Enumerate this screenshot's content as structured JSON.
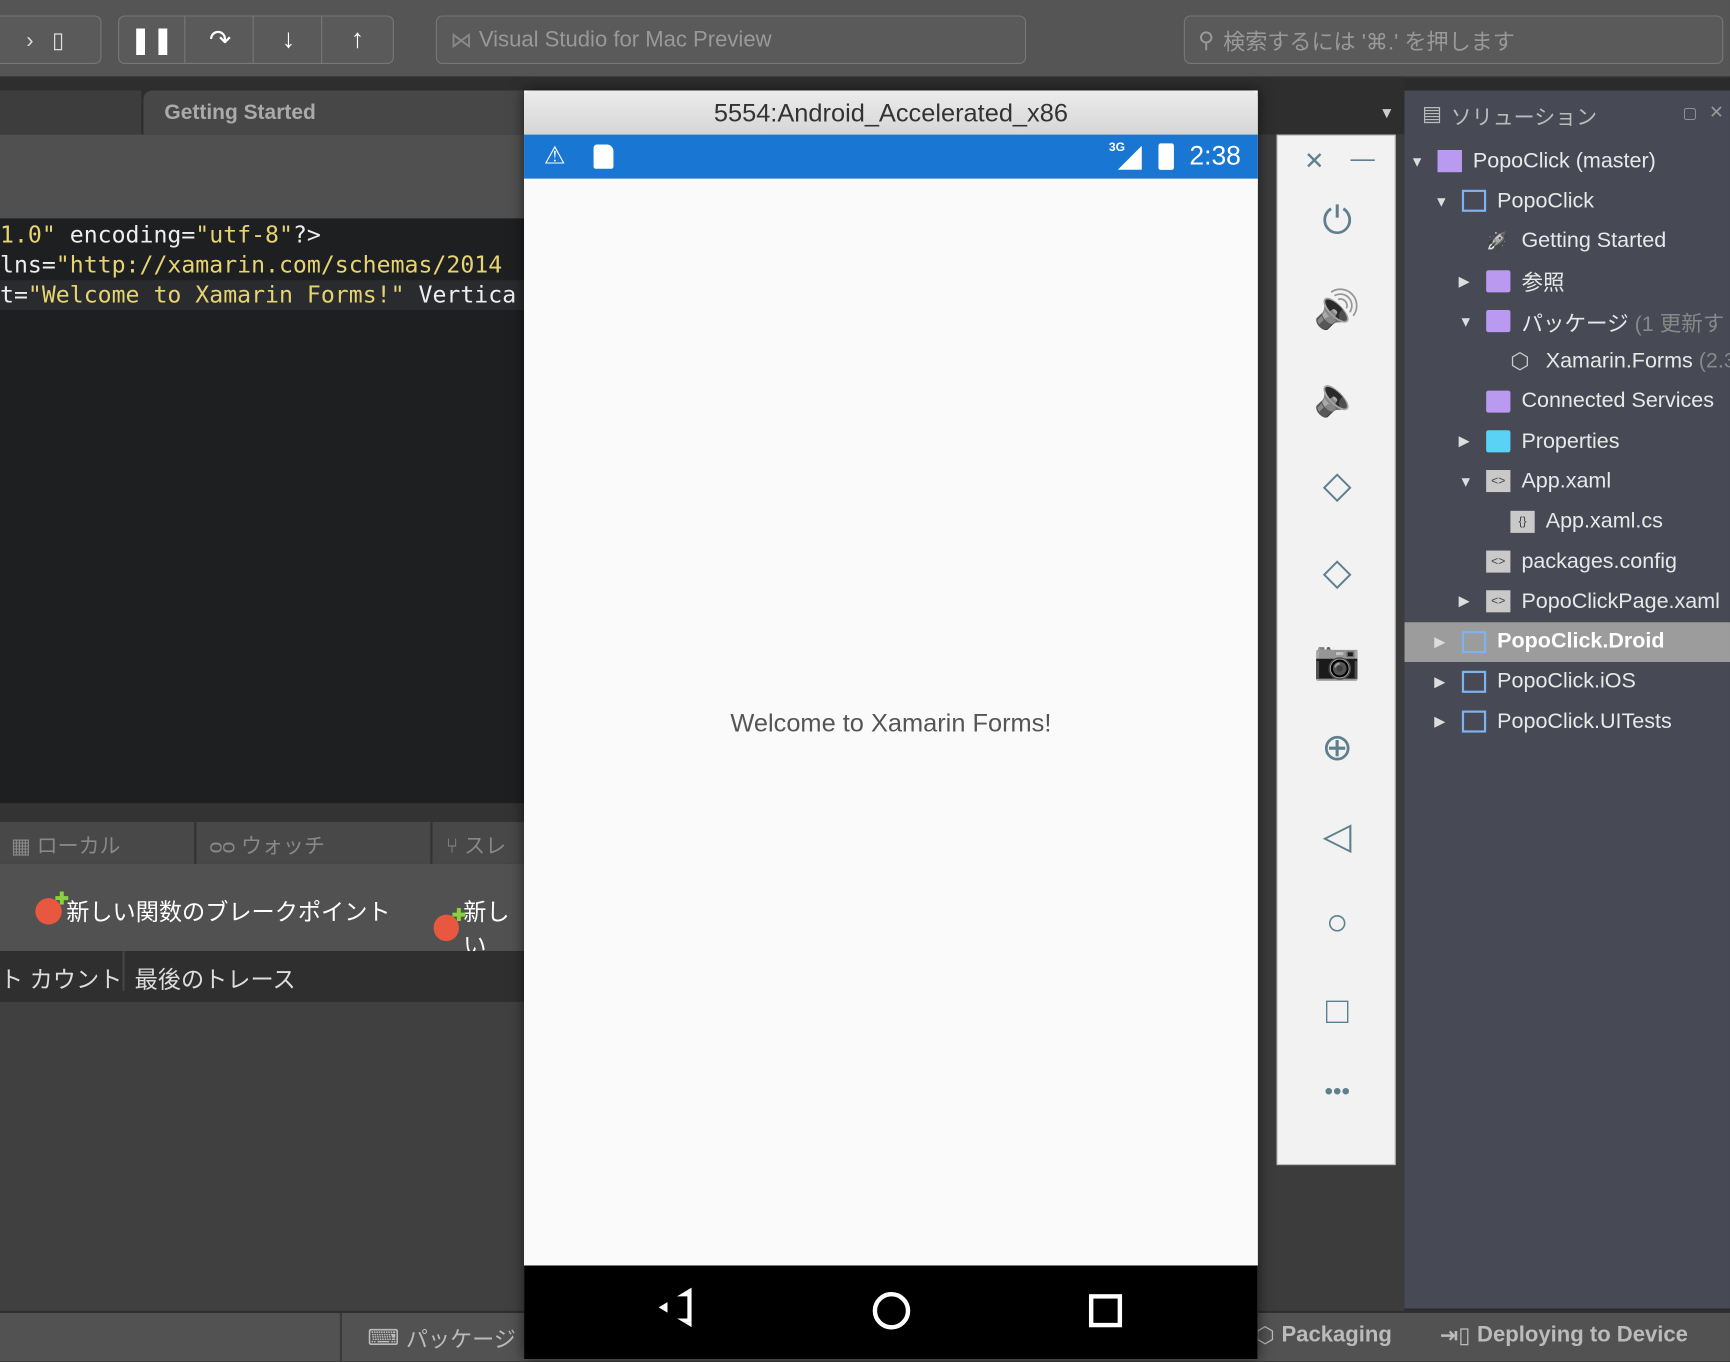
{
  "toolbar": {
    "app_title": "Visual Studio for Mac Preview",
    "search_placeholder": "検索するには '⌘.' を押します",
    "debug_buttons": [
      "pause-icon",
      "step-over-icon",
      "step-into-icon",
      "step-out-icon"
    ]
  },
  "editor": {
    "tab_label": "Getting Started",
    "lines": [
      {
        "a": "1.0\"",
        "b": " encoding=",
        "c": "\"utf-8\"",
        "d": "?>"
      },
      {
        "a": "lns=",
        "b": "",
        "c": "\"http://xamarin.com/schemas/2014",
        "d": ""
      },
      {
        "a": "t=",
        "b": "",
        "c": "\"Welcome to Xamarin Forms!\"",
        "d": " Vertica"
      }
    ]
  },
  "debug_pad": {
    "tabs": [
      "ローカル",
      "ウォッチ",
      "スレ"
    ],
    "new_function_breakpoint": "新しい関数のブレークポイント",
    "new_exception": "新しい",
    "columns": [
      "ト カウント",
      "最後のトレース"
    ]
  },
  "statusbar": {
    "package_console": "パッケージ コ",
    "packaging": "Packaging",
    "deploying": "Deploying to Device"
  },
  "solution": {
    "title": "ソリューション",
    "items": [
      {
        "label": "PopoClick (master)",
        "extra": ""
      },
      {
        "label": "PopoClick",
        "extra": ""
      },
      {
        "label": "Getting Started",
        "extra": ""
      },
      {
        "label": "参照",
        "extra": ""
      },
      {
        "label": "パッケージ",
        "extra": " (1 更新す"
      },
      {
        "label": "Xamarin.Forms",
        "extra": " (2.3"
      },
      {
        "label": "Connected Services",
        "extra": ""
      },
      {
        "label": "Properties",
        "extra": ""
      },
      {
        "label": "App.xaml",
        "extra": ""
      },
      {
        "label": "App.xaml.cs",
        "extra": ""
      },
      {
        "label": "packages.config",
        "extra": ""
      },
      {
        "label": "PopoClickPage.xaml",
        "extra": ""
      },
      {
        "label": "PopoClick.Droid",
        "extra": ""
      },
      {
        "label": "PopoClick.iOS",
        "extra": ""
      },
      {
        "label": "PopoClick.UITests",
        "extra": ""
      }
    ],
    "selected": "PopoClick.Droid"
  },
  "emulator": {
    "title": "5554:Android_Accelerated_x86",
    "network": "3G",
    "time": "2:38",
    "content_text": "Welcome to Xamarin Forms!",
    "status_color": "#1976d2",
    "side_controls": [
      "power-icon",
      "volume-up-icon",
      "volume-down-icon",
      "rotate-left-icon",
      "rotate-right-icon",
      "camera-icon",
      "zoom-icon",
      "back-icon",
      "home-icon",
      "overview-icon",
      "more-icon"
    ]
  }
}
